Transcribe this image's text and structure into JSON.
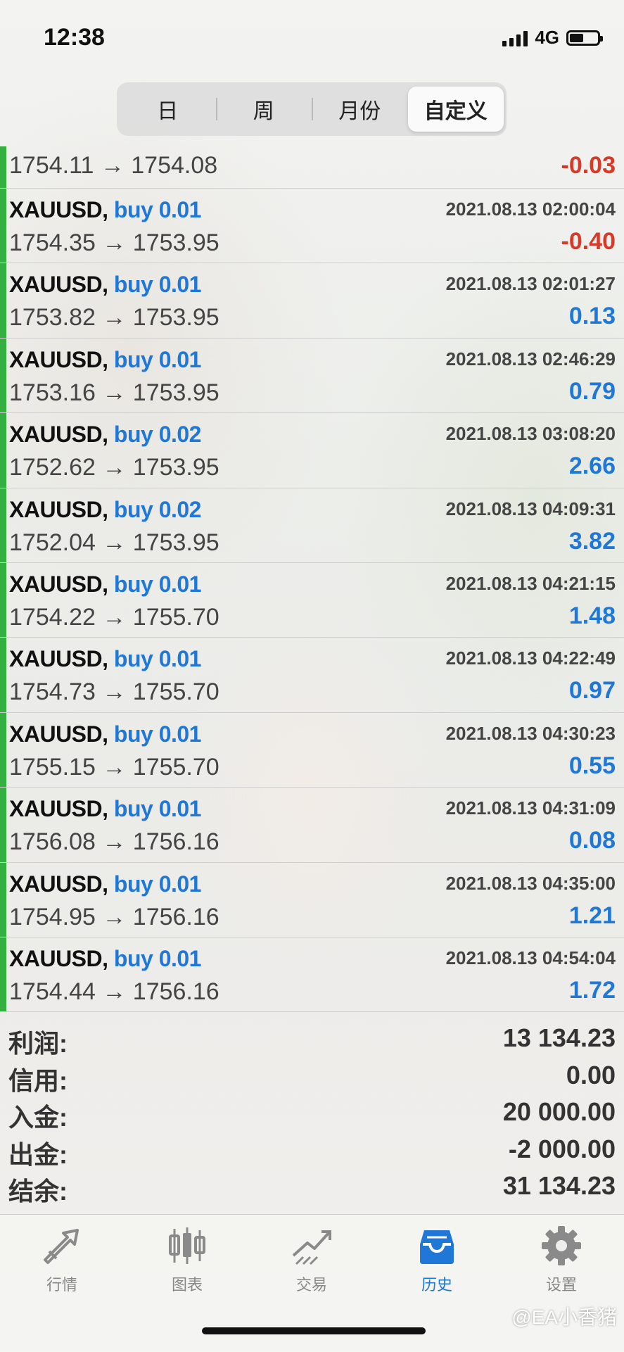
{
  "status_bar": {
    "time": "12:38",
    "network": "4G"
  },
  "period_tabs": [
    "日",
    "周",
    "月份",
    "自定义"
  ],
  "active_tab_index": 3,
  "colors": {
    "buy": "#1f78d8",
    "positive": "#1f78d8",
    "negative": "#d83a28",
    "accent": "#33b040"
  },
  "first_row": {
    "prices": "1754.11 → 1754.08",
    "profit": "-0.03"
  },
  "trades": [
    {
      "symbol": "XAUUSD,",
      "side": "buy 0.01",
      "date": "2021.08.13 02:00:04",
      "prices": "1754.35 → 1753.95",
      "profit": "-0.40"
    },
    {
      "symbol": "XAUUSD,",
      "side": "buy 0.01",
      "date": "2021.08.13 02:01:27",
      "prices": "1753.82 → 1753.95",
      "profit": "0.13"
    },
    {
      "symbol": "XAUUSD,",
      "side": "buy 0.01",
      "date": "2021.08.13 02:46:29",
      "prices": "1753.16 → 1753.95",
      "profit": "0.79"
    },
    {
      "symbol": "XAUUSD,",
      "side": "buy 0.02",
      "date": "2021.08.13 03:08:20",
      "prices": "1752.62 → 1753.95",
      "profit": "2.66"
    },
    {
      "symbol": "XAUUSD,",
      "side": "buy 0.02",
      "date": "2021.08.13 04:09:31",
      "prices": "1752.04 → 1753.95",
      "profit": "3.82"
    },
    {
      "symbol": "XAUUSD,",
      "side": "buy 0.01",
      "date": "2021.08.13 04:21:15",
      "prices": "1754.22 → 1755.70",
      "profit": "1.48"
    },
    {
      "symbol": "XAUUSD,",
      "side": "buy 0.01",
      "date": "2021.08.13 04:22:49",
      "prices": "1754.73 → 1755.70",
      "profit": "0.97"
    },
    {
      "symbol": "XAUUSD,",
      "side": "buy 0.01",
      "date": "2021.08.13 04:30:23",
      "prices": "1755.15 → 1755.70",
      "profit": "0.55"
    },
    {
      "symbol": "XAUUSD,",
      "side": "buy 0.01",
      "date": "2021.08.13 04:31:09",
      "prices": "1756.08 → 1756.16",
      "profit": "0.08"
    },
    {
      "symbol": "XAUUSD,",
      "side": "buy 0.01",
      "date": "2021.08.13 04:35:00",
      "prices": "1754.95 → 1756.16",
      "profit": "1.21"
    },
    {
      "symbol": "XAUUSD,",
      "side": "buy 0.01",
      "date": "2021.08.13 04:54:04",
      "prices": "1754.44 → 1756.16",
      "profit": "1.72"
    }
  ],
  "summary": [
    {
      "label": "利润:",
      "value": "13 134.23"
    },
    {
      "label": "信用:",
      "value": "0.00"
    },
    {
      "label": "入金:",
      "value": "20 000.00"
    },
    {
      "label": "出金:",
      "value": "-2 000.00"
    },
    {
      "label": "结余:",
      "value": "31 134.23"
    }
  ],
  "bottom_tabs": [
    {
      "label": "行情",
      "icon": "quotes-icon"
    },
    {
      "label": "图表",
      "icon": "chart-icon"
    },
    {
      "label": "交易",
      "icon": "trade-icon"
    },
    {
      "label": "历史",
      "icon": "history-icon"
    },
    {
      "label": "设置",
      "icon": "settings-icon"
    }
  ],
  "active_bottom_tab_index": 3,
  "watermark": "@EA小香猪"
}
